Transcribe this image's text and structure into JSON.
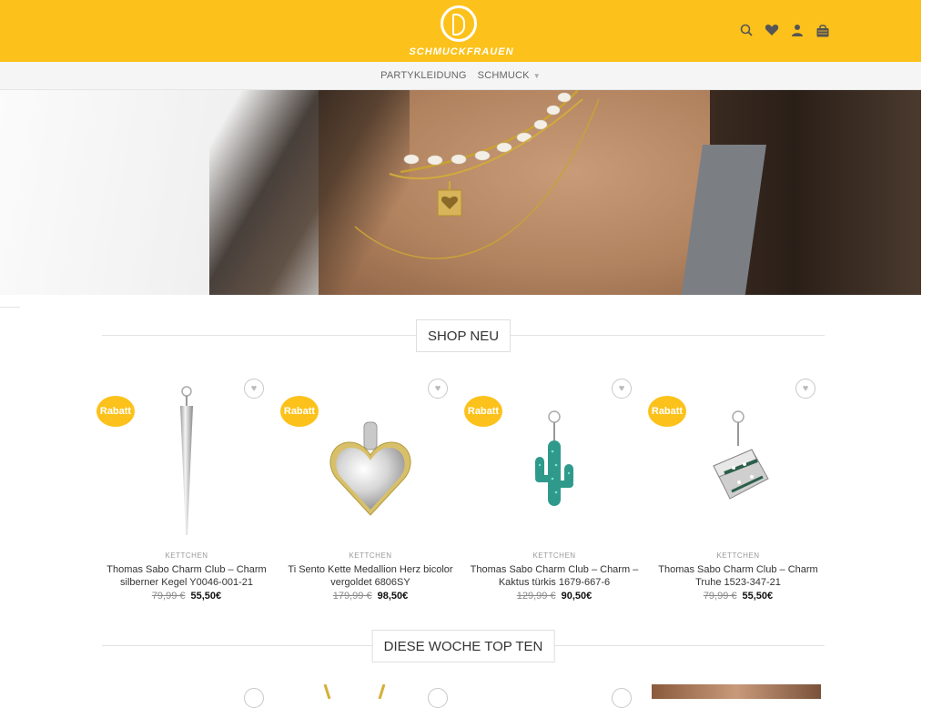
{
  "header": {
    "logo_text": "SCHMUCKFRAUEN",
    "icons": [
      "search-icon",
      "heart-icon",
      "user-icon",
      "cart-icon"
    ],
    "background": "#fcc21b"
  },
  "nav": {
    "items": [
      {
        "label": "PARTYKLEIDUNG"
      },
      {
        "label": "SCHMUCK"
      }
    ]
  },
  "sections": {
    "shop_new": "SHOP NEU",
    "top_ten": "DIESE WOCHE TOP TEN"
  },
  "products": [
    {
      "badge": "Rabatt",
      "category": "KETTCHEN",
      "name": "Thomas Sabo Charm Club – Charm silberner Kegel Y0046-001-21",
      "old_price": "79,99 €",
      "price": "55,50€",
      "icon": "cone-charm"
    },
    {
      "badge": "Rabatt",
      "category": "KETTCHEN",
      "name": "Ti Sento Kette Medallion Herz bicolor vergoldet 6806SY",
      "old_price": "179,99 €",
      "price": "98,50€",
      "icon": "heart-medallion"
    },
    {
      "badge": "Rabatt",
      "category": "KETTCHEN",
      "name": "Thomas Sabo Charm Club – Charm – Kaktus türkis 1679-667-6",
      "old_price": "129,99 €",
      "price": "90,50€",
      "icon": "cactus-charm"
    },
    {
      "badge": "Rabatt",
      "category": "KETTCHEN",
      "name": "Thomas Sabo Charm Club – Charm Truhe 1523-347-21",
      "old_price": "79,99 €",
      "price": "55,50€",
      "icon": "chest-charm"
    }
  ]
}
